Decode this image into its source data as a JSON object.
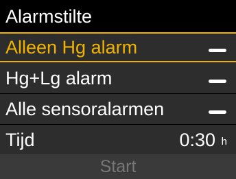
{
  "screen": {
    "title": "Alarmstilte"
  },
  "options": [
    {
      "label": "Alleen Hg alarm",
      "icon": "minus-toggle-icon",
      "selected": true
    },
    {
      "label": "Hg+Lg alarm",
      "icon": "minus-toggle-icon",
      "selected": false
    },
    {
      "label": "Alle sensoralarmen",
      "icon": "minus-toggle-icon",
      "selected": false
    }
  ],
  "time": {
    "label": "Tijd",
    "value": "0:30",
    "unit": "h"
  },
  "start": {
    "label": "Start",
    "enabled": false
  },
  "colors": {
    "accent": "#f0b400",
    "row_bg": "#2d2d2d",
    "disabled_text": "#777777"
  }
}
